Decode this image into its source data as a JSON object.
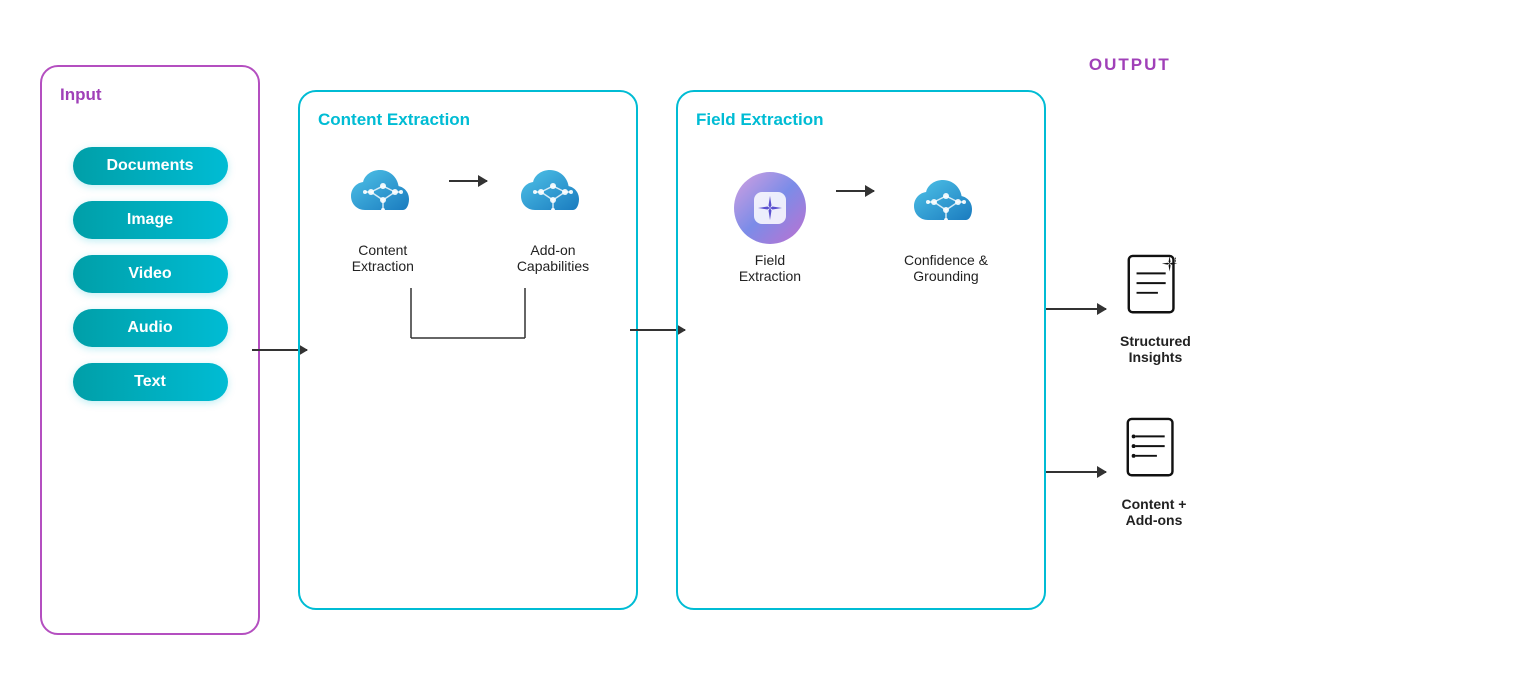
{
  "input": {
    "title": "Input",
    "buttons": [
      "Documents",
      "Image",
      "Video",
      "Audio",
      "Text"
    ]
  },
  "contentExtraction": {
    "title": "Content Extraction",
    "nodes": [
      {
        "label": "Content\nExtraction"
      },
      {
        "label": "Add-on\nCapabilities"
      }
    ]
  },
  "fieldExtraction": {
    "title": "Field Extraction",
    "nodes": [
      {
        "label": "Field\nExtraction"
      },
      {
        "label": "Confidence &\nGrounding"
      }
    ]
  },
  "output": {
    "title": "OUTPUT",
    "items": [
      {
        "label": "Structured\nInsights"
      },
      {
        "label": "Content +\nAdd-ons"
      }
    ]
  }
}
